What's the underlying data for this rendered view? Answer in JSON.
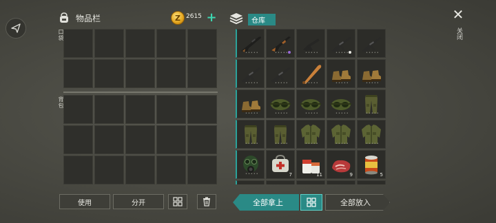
{
  "inventory": {
    "title": "物品栏",
    "coins": "2615",
    "coin_symbol": "Z",
    "add_coins": "+",
    "pocket_label": "口袋",
    "backpack_label": "背包"
  },
  "actions": {
    "use_label": "使用",
    "split_label": "分开"
  },
  "warehouse": {
    "title": "仓库",
    "close_label": "关闭",
    "items": [
      {
        "name": "rifle",
        "quantity": "",
        "durability": "•••••",
        "mod": ""
      },
      {
        "name": "ak-rifle",
        "quantity": "",
        "durability": "•••••",
        "mod": "purple"
      },
      {
        "name": "smg",
        "quantity": "",
        "durability": "•••••",
        "mod": ""
      },
      {
        "name": "assault-rifle",
        "quantity": "",
        "durability": "•••••",
        "mod": "white"
      },
      {
        "name": "assault-rifle",
        "quantity": "",
        "durability": "•••••",
        "mod": ""
      },
      {
        "name": "assault-rifle",
        "quantity": "",
        "durability": "•••••",
        "mod": ""
      },
      {
        "name": "assault-rifle",
        "quantity": "",
        "durability": "•••••",
        "mod": ""
      },
      {
        "name": "baseball-bat",
        "quantity": "",
        "durability": "•••••",
        "mod": ""
      },
      {
        "name": "boots",
        "quantity": "",
        "durability": "•••••",
        "mod": ""
      },
      {
        "name": "boots",
        "quantity": "",
        "durability": "•••••",
        "mod": ""
      },
      {
        "name": "boots",
        "quantity": "",
        "durability": "•••••",
        "mod": ""
      },
      {
        "name": "goggles",
        "quantity": "",
        "durability": "•••••",
        "mod": ""
      },
      {
        "name": "goggles",
        "quantity": "",
        "durability": "•••••",
        "mod": ""
      },
      {
        "name": "goggles",
        "quantity": "",
        "durability": "•••••",
        "mod": ""
      },
      {
        "name": "pants",
        "quantity": "",
        "durability": "•••••",
        "mod": ""
      },
      {
        "name": "pants",
        "quantity": "",
        "durability": "•••••",
        "mod": ""
      },
      {
        "name": "pants",
        "quantity": "",
        "durability": "•••••",
        "mod": ""
      },
      {
        "name": "jacket",
        "quantity": "",
        "durability": "•••••",
        "mod": ""
      },
      {
        "name": "jacket",
        "quantity": "",
        "durability": "•••••",
        "mod": ""
      },
      {
        "name": "jacket",
        "quantity": "",
        "durability": "•••••",
        "mod": ""
      },
      {
        "name": "gas-mask",
        "quantity": "",
        "durability": "•••••",
        "mod": ""
      },
      {
        "name": "first-aid-bag",
        "quantity": "7",
        "durability": "",
        "mod": ""
      },
      {
        "name": "pills",
        "quantity": "11",
        "durability": "",
        "mod": ""
      },
      {
        "name": "raw-meat",
        "quantity": "9",
        "durability": "",
        "mod": ""
      },
      {
        "name": "canned-food",
        "quantity": "5",
        "durability": "",
        "mod": ""
      },
      {
        "name": "partial-item",
        "quantity": "",
        "durability": "",
        "mod": ""
      },
      {
        "name": "partial-item",
        "quantity": "",
        "durability": "",
        "mod": ""
      },
      {
        "name": "partial-item",
        "quantity": "",
        "durability": "",
        "mod": ""
      },
      {
        "name": "partial-item",
        "quantity": "",
        "durability": "",
        "mod": ""
      },
      {
        "name": "partial-item",
        "quantity": "",
        "durability": "",
        "mod": ""
      }
    ],
    "take_all_label": "全部拿上",
    "put_all_label": "全部放入"
  },
  "colors": {
    "accent": "#2a8a86",
    "plus": "#3dd6b0",
    "slot": "#2f2f2b"
  }
}
